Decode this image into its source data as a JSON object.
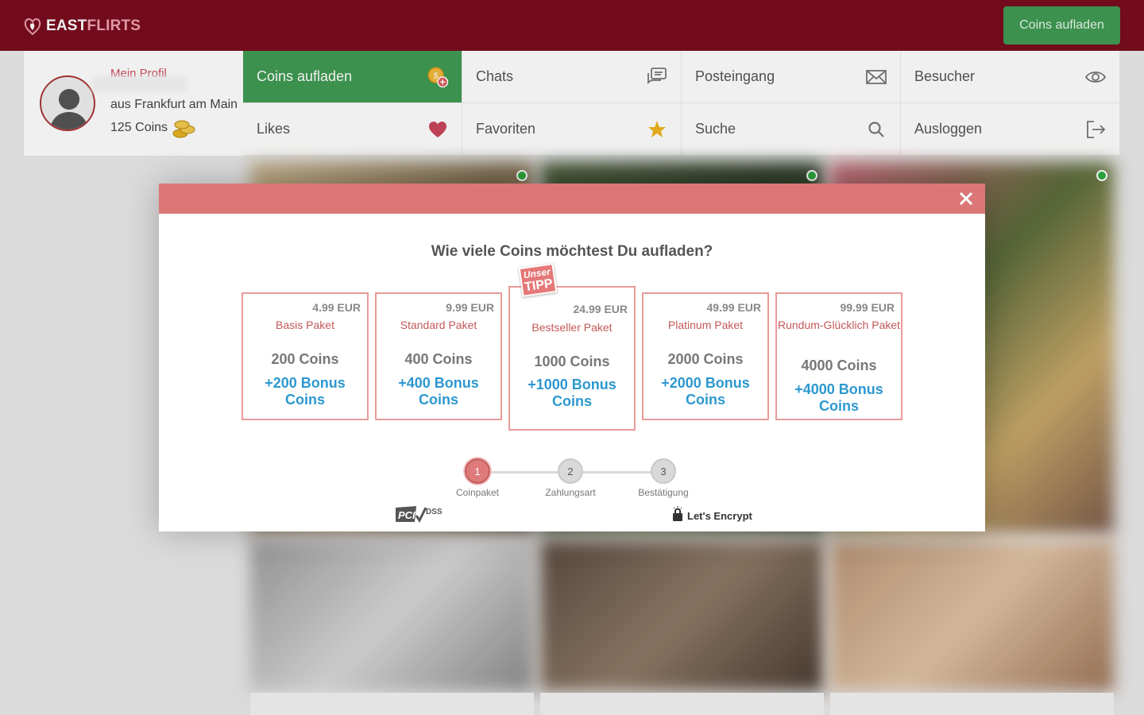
{
  "header": {
    "logo_part1": "EAST",
    "logo_part2": "FLIRTS",
    "coins_button": "Coins aufladen"
  },
  "profile": {
    "link_label": "Mein Profil",
    "location": "aus Frankfurt am Main",
    "coins": "125 Coins"
  },
  "nav": [
    {
      "label": "Coins aufladen",
      "icon": "coins-add-icon"
    },
    {
      "label": "Chats",
      "icon": "chat-icon"
    },
    {
      "label": "Posteingang",
      "icon": "mail-icon"
    },
    {
      "label": "Besucher",
      "icon": "eye-icon"
    },
    {
      "label": "Likes",
      "icon": "heart-icon"
    },
    {
      "label": "Favoriten",
      "icon": "star-icon"
    },
    {
      "label": "Suche",
      "icon": "search-icon"
    },
    {
      "label": "Ausloggen",
      "icon": "logout-icon"
    }
  ],
  "modal": {
    "title": "Wie viele Coins möchtest Du aufladen?",
    "tip_badge_top": "Unser",
    "tip_badge_bottom": "TIPP",
    "packages": [
      {
        "price": "4.99 EUR",
        "name": "Basis Paket",
        "coins": "200 Coins",
        "bonus": "+200 Bonus Coins"
      },
      {
        "price": "9.99 EUR",
        "name": "Standard Paket",
        "coins": "400 Coins",
        "bonus": "+400 Bonus Coins"
      },
      {
        "price": "24.99 EUR",
        "name": "Bestseller Paket",
        "coins": "1000 Coins",
        "bonus": "+1000 Bonus Coins"
      },
      {
        "price": "49.99 EUR",
        "name": "Platinum Paket",
        "coins": "2000 Coins",
        "bonus": "+2000 Bonus Coins"
      },
      {
        "price": "99.99 EUR",
        "name": "Rundum-Glücklich Paket",
        "coins": "4000 Coins",
        "bonus": "+4000 Bonus Coins"
      }
    ],
    "steps": [
      {
        "number": "1",
        "label": "Coinpaket"
      },
      {
        "number": "2",
        "label": "Zahlungsart"
      },
      {
        "number": "3",
        "label": "Bestätigung"
      }
    ],
    "badges": {
      "pci": "PCI DSS",
      "letsencrypt": "Let's Encrypt"
    }
  },
  "colors": {
    "header_bg": "#7a0d1f",
    "accent_green": "#3f9b52",
    "modal_header": "#dc7777",
    "bonus_blue": "#2d98cf",
    "package_border": "#ea9a9a"
  }
}
